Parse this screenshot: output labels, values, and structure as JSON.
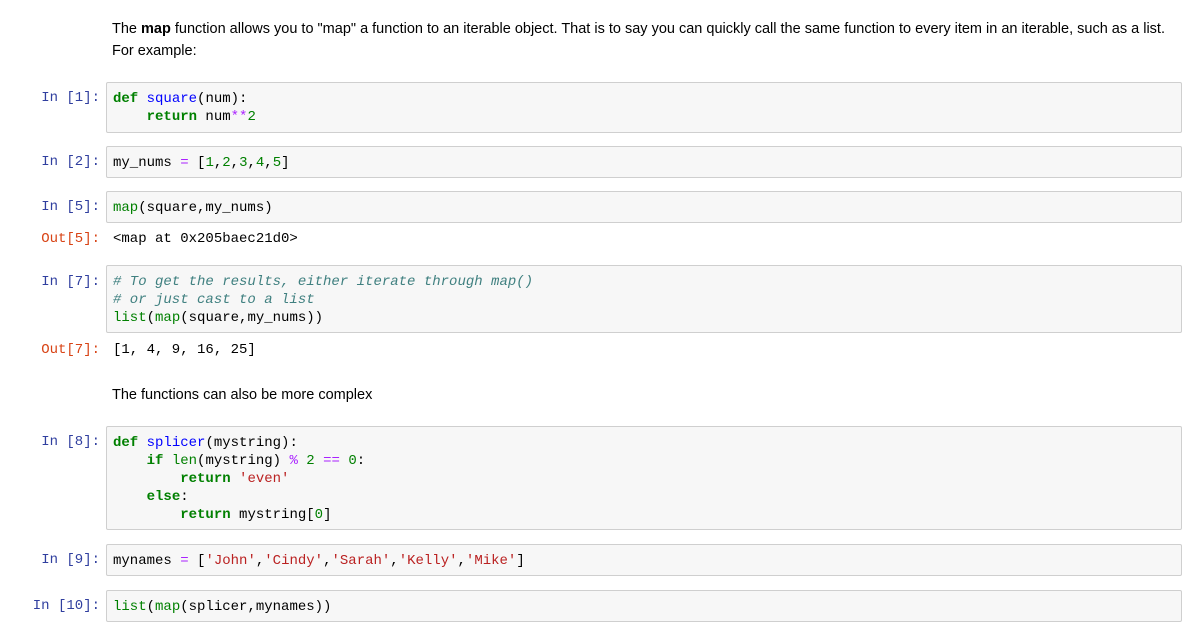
{
  "markdown": {
    "para1": {
      "before": "The ",
      "bold": "map",
      "after": " function allows you to \"map\" a function to an iterable object. That is to say you can quickly call the same function to every item in an iterable, such as a list. For example:"
    },
    "para2": "The functions can also be more complex"
  },
  "cells": [
    {
      "prompt": "In [1]:",
      "lines": [
        [
          {
            "t": "def",
            "c": "kw"
          },
          {
            "t": " ",
            "c": "pl"
          },
          {
            "t": "square",
            "c": "fn"
          },
          {
            "t": "(num):",
            "c": "pl"
          }
        ],
        [
          {
            "t": "    ",
            "c": "pl"
          },
          {
            "t": "return",
            "c": "kw"
          },
          {
            "t": " num",
            "c": "pl"
          },
          {
            "t": "**",
            "c": "op"
          },
          {
            "t": "2",
            "c": "num"
          }
        ]
      ]
    },
    {
      "prompt": "In [2]:",
      "lines": [
        [
          {
            "t": "my_nums ",
            "c": "pl"
          },
          {
            "t": "=",
            "c": "op"
          },
          {
            "t": " [",
            "c": "pl"
          },
          {
            "t": "1",
            "c": "num"
          },
          {
            "t": ",",
            "c": "pl"
          },
          {
            "t": "2",
            "c": "num"
          },
          {
            "t": ",",
            "c": "pl"
          },
          {
            "t": "3",
            "c": "num"
          },
          {
            "t": ",",
            "c": "pl"
          },
          {
            "t": "4",
            "c": "num"
          },
          {
            "t": ",",
            "c": "pl"
          },
          {
            "t": "5",
            "c": "num"
          },
          {
            "t": "]",
            "c": "pl"
          }
        ]
      ]
    },
    {
      "prompt": "In [5]:",
      "lines": [
        [
          {
            "t": "map",
            "c": "bi"
          },
          {
            "t": "(square,my_nums)",
            "c": "pl"
          }
        ]
      ],
      "out_prompt": "Out[5]:",
      "output": "<map at 0x205baec21d0>"
    },
    {
      "prompt": "In [7]:",
      "lines": [
        [
          {
            "t": "# To get the results, either iterate through map()",
            "c": "cm"
          }
        ],
        [
          {
            "t": "# or just cast to a list",
            "c": "cm"
          }
        ],
        [
          {
            "t": "list",
            "c": "bi"
          },
          {
            "t": "(",
            "c": "pl"
          },
          {
            "t": "map",
            "c": "bi"
          },
          {
            "t": "(square,my_nums))",
            "c": "pl"
          }
        ]
      ],
      "out_prompt": "Out[7]:",
      "output": "[1, 4, 9, 16, 25]"
    },
    {
      "prompt": "In [8]:",
      "lines": [
        [
          {
            "t": "def",
            "c": "kw"
          },
          {
            "t": " ",
            "c": "pl"
          },
          {
            "t": "splicer",
            "c": "fn"
          },
          {
            "t": "(mystring):",
            "c": "pl"
          }
        ],
        [
          {
            "t": "    ",
            "c": "pl"
          },
          {
            "t": "if",
            "c": "kw"
          },
          {
            "t": " ",
            "c": "pl"
          },
          {
            "t": "len",
            "c": "bi"
          },
          {
            "t": "(mystring) ",
            "c": "pl"
          },
          {
            "t": "%",
            "c": "op"
          },
          {
            "t": " ",
            "c": "pl"
          },
          {
            "t": "2",
            "c": "num"
          },
          {
            "t": " ",
            "c": "pl"
          },
          {
            "t": "==",
            "c": "op"
          },
          {
            "t": " ",
            "c": "pl"
          },
          {
            "t": "0",
            "c": "num"
          },
          {
            "t": ":",
            "c": "pl"
          }
        ],
        [
          {
            "t": "        ",
            "c": "pl"
          },
          {
            "t": "return",
            "c": "kw"
          },
          {
            "t": " ",
            "c": "pl"
          },
          {
            "t": "'even'",
            "c": "str"
          }
        ],
        [
          {
            "t": "    ",
            "c": "pl"
          },
          {
            "t": "else",
            "c": "kw"
          },
          {
            "t": ":",
            "c": "pl"
          }
        ],
        [
          {
            "t": "        ",
            "c": "pl"
          },
          {
            "t": "return",
            "c": "kw"
          },
          {
            "t": " mystring[",
            "c": "pl"
          },
          {
            "t": "0",
            "c": "num"
          },
          {
            "t": "]",
            "c": "pl"
          }
        ]
      ]
    },
    {
      "prompt": "In [9]:",
      "lines": [
        [
          {
            "t": "mynames ",
            "c": "pl"
          },
          {
            "t": "=",
            "c": "op"
          },
          {
            "t": " [",
            "c": "pl"
          },
          {
            "t": "'John'",
            "c": "str"
          },
          {
            "t": ",",
            "c": "pl"
          },
          {
            "t": "'Cindy'",
            "c": "str"
          },
          {
            "t": ",",
            "c": "pl"
          },
          {
            "t": "'Sarah'",
            "c": "str"
          },
          {
            "t": ",",
            "c": "pl"
          },
          {
            "t": "'Kelly'",
            "c": "str"
          },
          {
            "t": ",",
            "c": "pl"
          },
          {
            "t": "'Mike'",
            "c": "str"
          },
          {
            "t": "]",
            "c": "pl"
          }
        ]
      ]
    },
    {
      "prompt": "In [10]:",
      "lines": [
        [
          {
            "t": "list",
            "c": "bi"
          },
          {
            "t": "(",
            "c": "pl"
          },
          {
            "t": "map",
            "c": "bi"
          },
          {
            "t": "(splicer,mynames))",
            "c": "pl"
          }
        ]
      ]
    }
  ],
  "colors": {
    "prompt_in": "#303F9F",
    "prompt_out": "#D84315",
    "cell_background": "#f7f7f7",
    "cell_border": "#cfcfcf",
    "keyword": "#008000",
    "function_name": "#0000FF",
    "string": "#BA2121",
    "operator": "#AA22FF",
    "comment": "#408080"
  }
}
